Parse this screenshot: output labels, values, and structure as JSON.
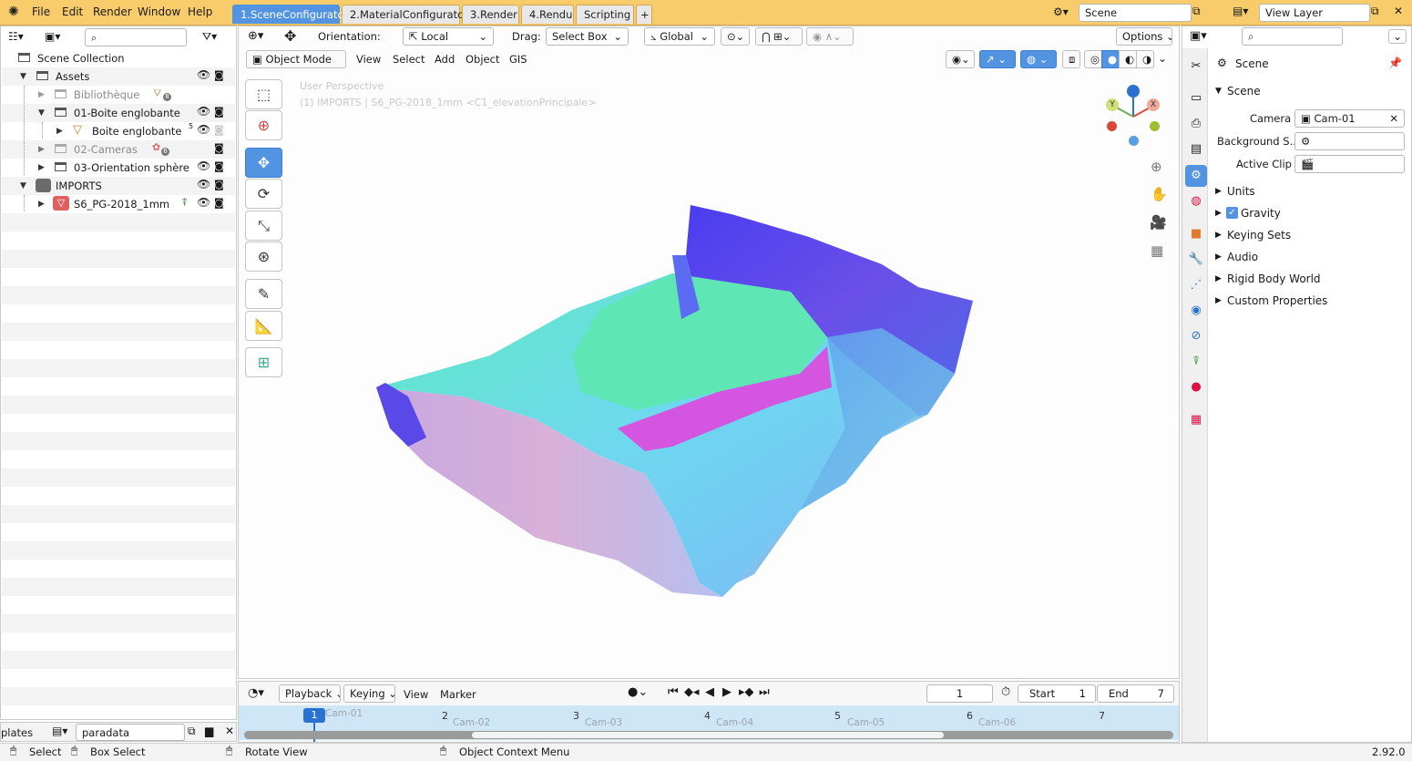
{
  "topbar": {
    "menus": [
      "File",
      "Edit",
      "Render",
      "Window",
      "Help"
    ],
    "workspaces": [
      "1.SceneConfigurator",
      "2.MaterialConfigurator",
      "3.Render",
      "4.Rendu",
      "Scripting"
    ],
    "add_workspace": "+",
    "scene_name": "Scene",
    "view_layer": "View Layer"
  },
  "outliner": {
    "search_placeholder": "",
    "rows": [
      {
        "label": "Scene Collection"
      },
      {
        "label": "Assets"
      },
      {
        "label": "Bibliothèque",
        "badge": "8"
      },
      {
        "label": "01-Boite englobante"
      },
      {
        "label": "Boite englobante",
        "badge": "5"
      },
      {
        "label": "02-Cameras",
        "badge": "6"
      },
      {
        "label": "03-Orientation sphère"
      },
      {
        "label": "IMPORTS"
      },
      {
        "label": "S6_PG-2018_1mm"
      }
    ]
  },
  "file_browser": {
    "left_text": "plates",
    "field": "paradata"
  },
  "viewport": {
    "orientation_label": "Orientation:",
    "orientation_value": "Local",
    "drag_label": "Drag:",
    "drag_value": "Select Box",
    "transform_space": "Global",
    "options": "Options",
    "mode": "Object Mode",
    "menus": [
      "View",
      "Select",
      "Add",
      "Object",
      "GIS"
    ],
    "overlay_title": "User Perspective",
    "overlay_sub": "(1) IMPORTS | S6_PG-2018_1mm <C1_elevationPrincipale>",
    "gizmo": {
      "x": "X",
      "y": "Y"
    }
  },
  "timeline": {
    "menus": [
      "Playback",
      "Keying",
      "View",
      "Marker"
    ],
    "current_frame": "1",
    "start_label": "Start",
    "start": "1",
    "end_label": "End",
    "end": "7",
    "frames": [
      "1",
      "2",
      "3",
      "4",
      "5",
      "6",
      "7"
    ],
    "cams": [
      "Cam-01",
      "Cam-02",
      "Cam-03",
      "Cam-04",
      "Cam-05",
      "Cam-06"
    ]
  },
  "properties": {
    "header": "Scene",
    "section": "Scene",
    "camera_label": "Camera",
    "camera_value": "Cam-01",
    "background_label": "Background S...",
    "clip_label": "Active Clip",
    "panels": [
      "Units",
      "Gravity",
      "Keying Sets",
      "Audio",
      "Rigid Body World",
      "Custom Properties"
    ]
  },
  "statusbar": {
    "select": "Select",
    "box_select": "Box Select",
    "rotate": "Rotate View",
    "context": "Object Context Menu",
    "version": "2.92.0"
  },
  "colors": {
    "accent": "#5294e2",
    "topbar": "#f9cc6b"
  }
}
